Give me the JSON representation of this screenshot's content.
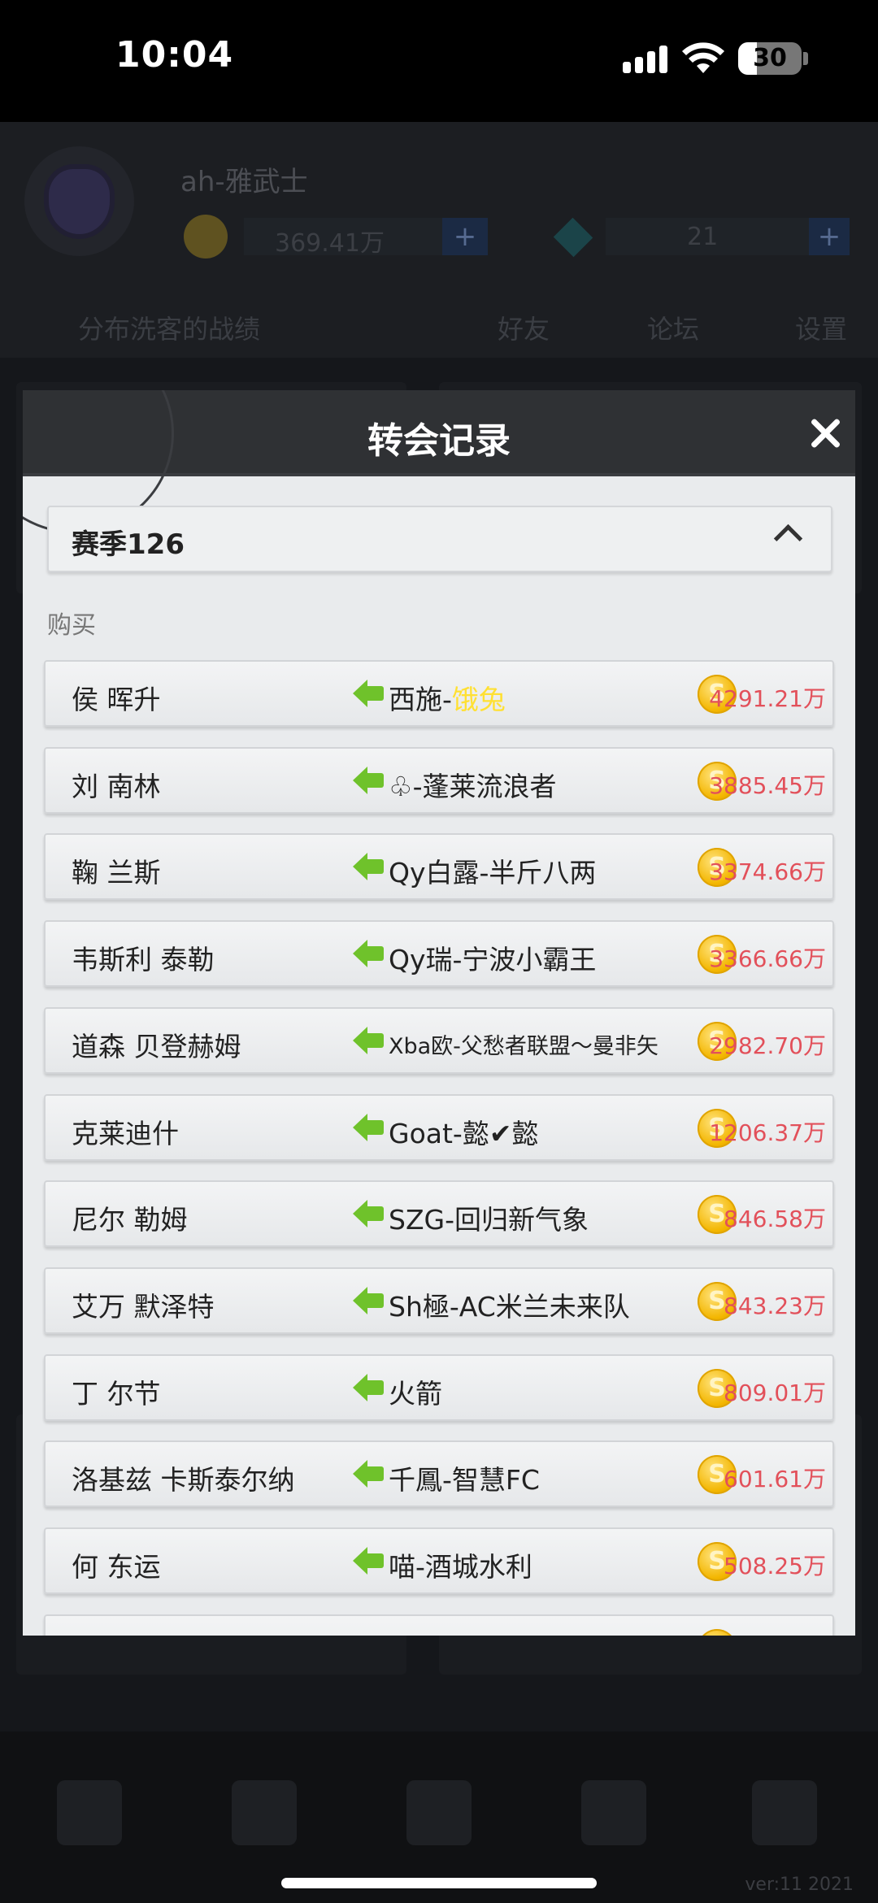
{
  "status_bar": {
    "time": "10:04",
    "battery": "30",
    "battery_level": 0.3
  },
  "background": {
    "username": "ah-雅武士",
    "coins": "369.41万",
    "gems": "21",
    "notice": "分布洗客的战绩",
    "friends": "好友",
    "forum": "论坛",
    "settings": "设置",
    "version": "ver:11  2021"
  },
  "modal": {
    "title": "转会记录",
    "season": "赛季126",
    "section_label": "购买",
    "rows": [
      {
        "player": "侯 晖升",
        "team": "西施-",
        "team_highlight": "饿兔",
        "price": "4291.21万"
      },
      {
        "player": "刘 南林",
        "team": "♧-蓬莱流浪者",
        "price": "3885.45万"
      },
      {
        "player": "鞠 兰斯",
        "team": "Qy白露-半斤八两",
        "price": "3374.66万"
      },
      {
        "player": "韦斯利 泰勒",
        "team": "Qy瑞-宁波小霸王",
        "price": "3366.66万"
      },
      {
        "player": "道森 贝登赫姆",
        "team": "Xba欧-父愁者联盟～曼非矢",
        "price": "2982.70万",
        "small": true
      },
      {
        "player": "克莱迪什",
        "team": "Goat-懿✔懿",
        "price": "1206.37万"
      },
      {
        "player": "尼尔 勒姆",
        "team": "SZG-回归新气象",
        "price": "846.58万"
      },
      {
        "player": "艾万 默泽特",
        "team": "Sh極-AC米兰未来队",
        "price": "843.23万"
      },
      {
        "player": "丁 尔节",
        "team": "火箭",
        "price": "809.01万"
      },
      {
        "player": "洛基兹 卡斯泰尔纳",
        "team": "千鳳-智慧FC",
        "price": "601.61万"
      },
      {
        "player": "何 东运",
        "team": "喵-酒城水利",
        "price": "508.25万"
      }
    ]
  },
  "colors": {
    "header": "#2f3134",
    "price": "#e2505a",
    "arrow": "#6fc22b",
    "highlight": "#ffe033"
  }
}
